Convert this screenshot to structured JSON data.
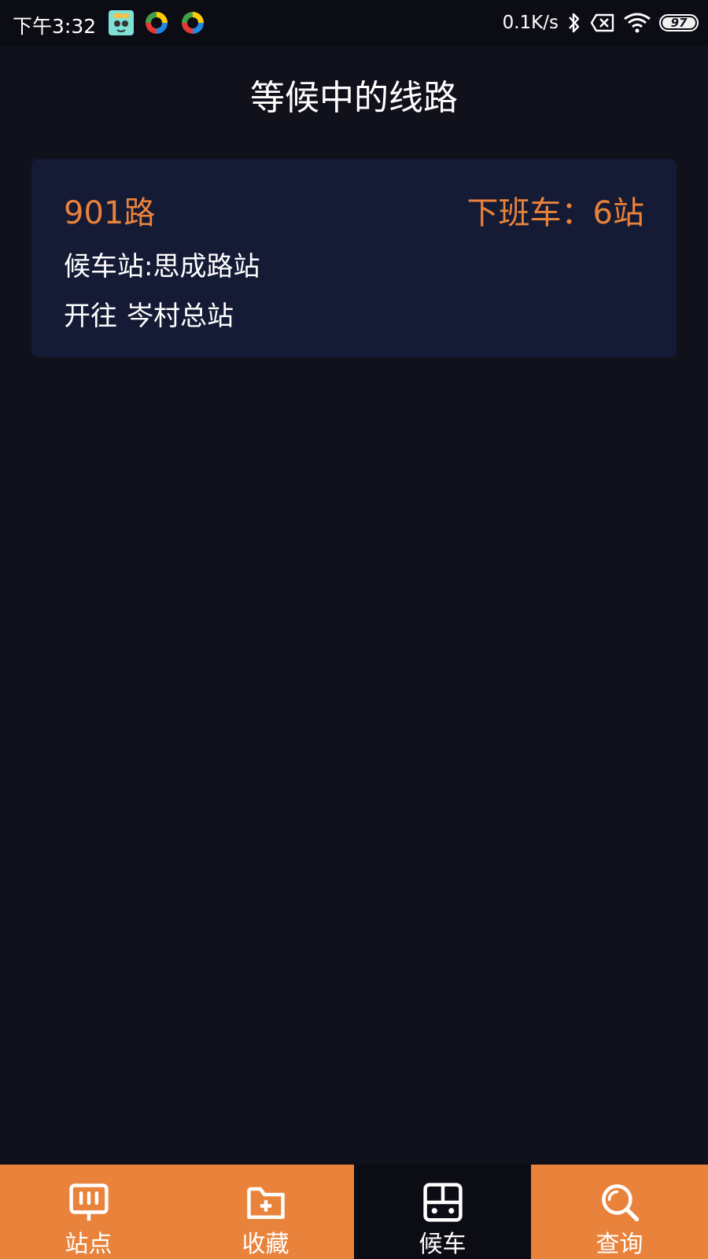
{
  "status_bar": {
    "time": "下午3:32",
    "net_speed": "0.1K/s",
    "battery": "97",
    "notification_icons": [
      "app-notification-icon",
      "sync-icon",
      "sync-icon"
    ]
  },
  "header": {
    "title": "等候中的线路"
  },
  "route_card": {
    "route_name": "901路",
    "next_bus": "下班车：6站",
    "wait_station": "候车站:思成路站",
    "direction_prefix": "开往",
    "direction_destination": "岑村总站"
  },
  "tab_bar": {
    "tabs": [
      {
        "label": "站点",
        "icon": "bus-stop-sign-icon",
        "active": false
      },
      {
        "label": "收藏",
        "icon": "folder-add-icon",
        "active": false
      },
      {
        "label": "候车",
        "icon": "bus-icon",
        "active": true
      },
      {
        "label": "查询",
        "icon": "search-icon",
        "active": false
      }
    ]
  },
  "colors": {
    "background": "#11111c",
    "card": "#151a35",
    "accent": "#e9833b",
    "status_bar": "#0c0c14"
  }
}
